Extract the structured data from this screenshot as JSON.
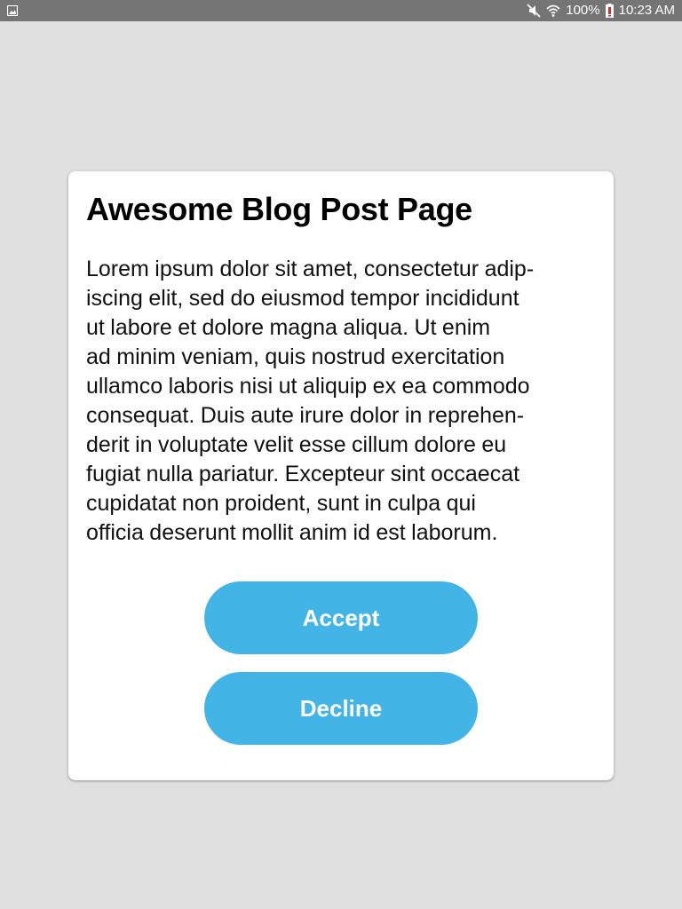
{
  "status_bar": {
    "battery_percent": "100%",
    "time": "10:23 AM",
    "icons": [
      "gallery-icon",
      "mute-icon",
      "wifi-icon",
      "battery-icon"
    ]
  },
  "dialog": {
    "title": "Awesome Blog Post Page",
    "body_lines": [
      "Lorem ipsum dolor sit amet, consectetur adip-",
      "iscing elit, sed do eiusmod tempor incididunt",
      "ut labore et dolore magna aliqua. Ut enim",
      "ad minim veniam, quis nostrud exercitation",
      "ullamco laboris nisi ut aliquip ex ea commodo",
      "consequat. Duis aute irure dolor in reprehen-",
      "derit in voluptate velit esse cillum dolore eu",
      "fugiat nulla pariatur. Excepteur sint occaecat",
      "cupidatat non proident, sunt in culpa qui",
      "officia deserunt mollit anim id est laborum."
    ],
    "accept_label": "Accept",
    "decline_label": "Decline"
  },
  "colors": {
    "background": "#e0e0e0",
    "status_bar": "#757575",
    "card": "#ffffff",
    "button": "#42b4e6",
    "button_text": "#ffffff",
    "battery_alert": "#d32f2f"
  }
}
